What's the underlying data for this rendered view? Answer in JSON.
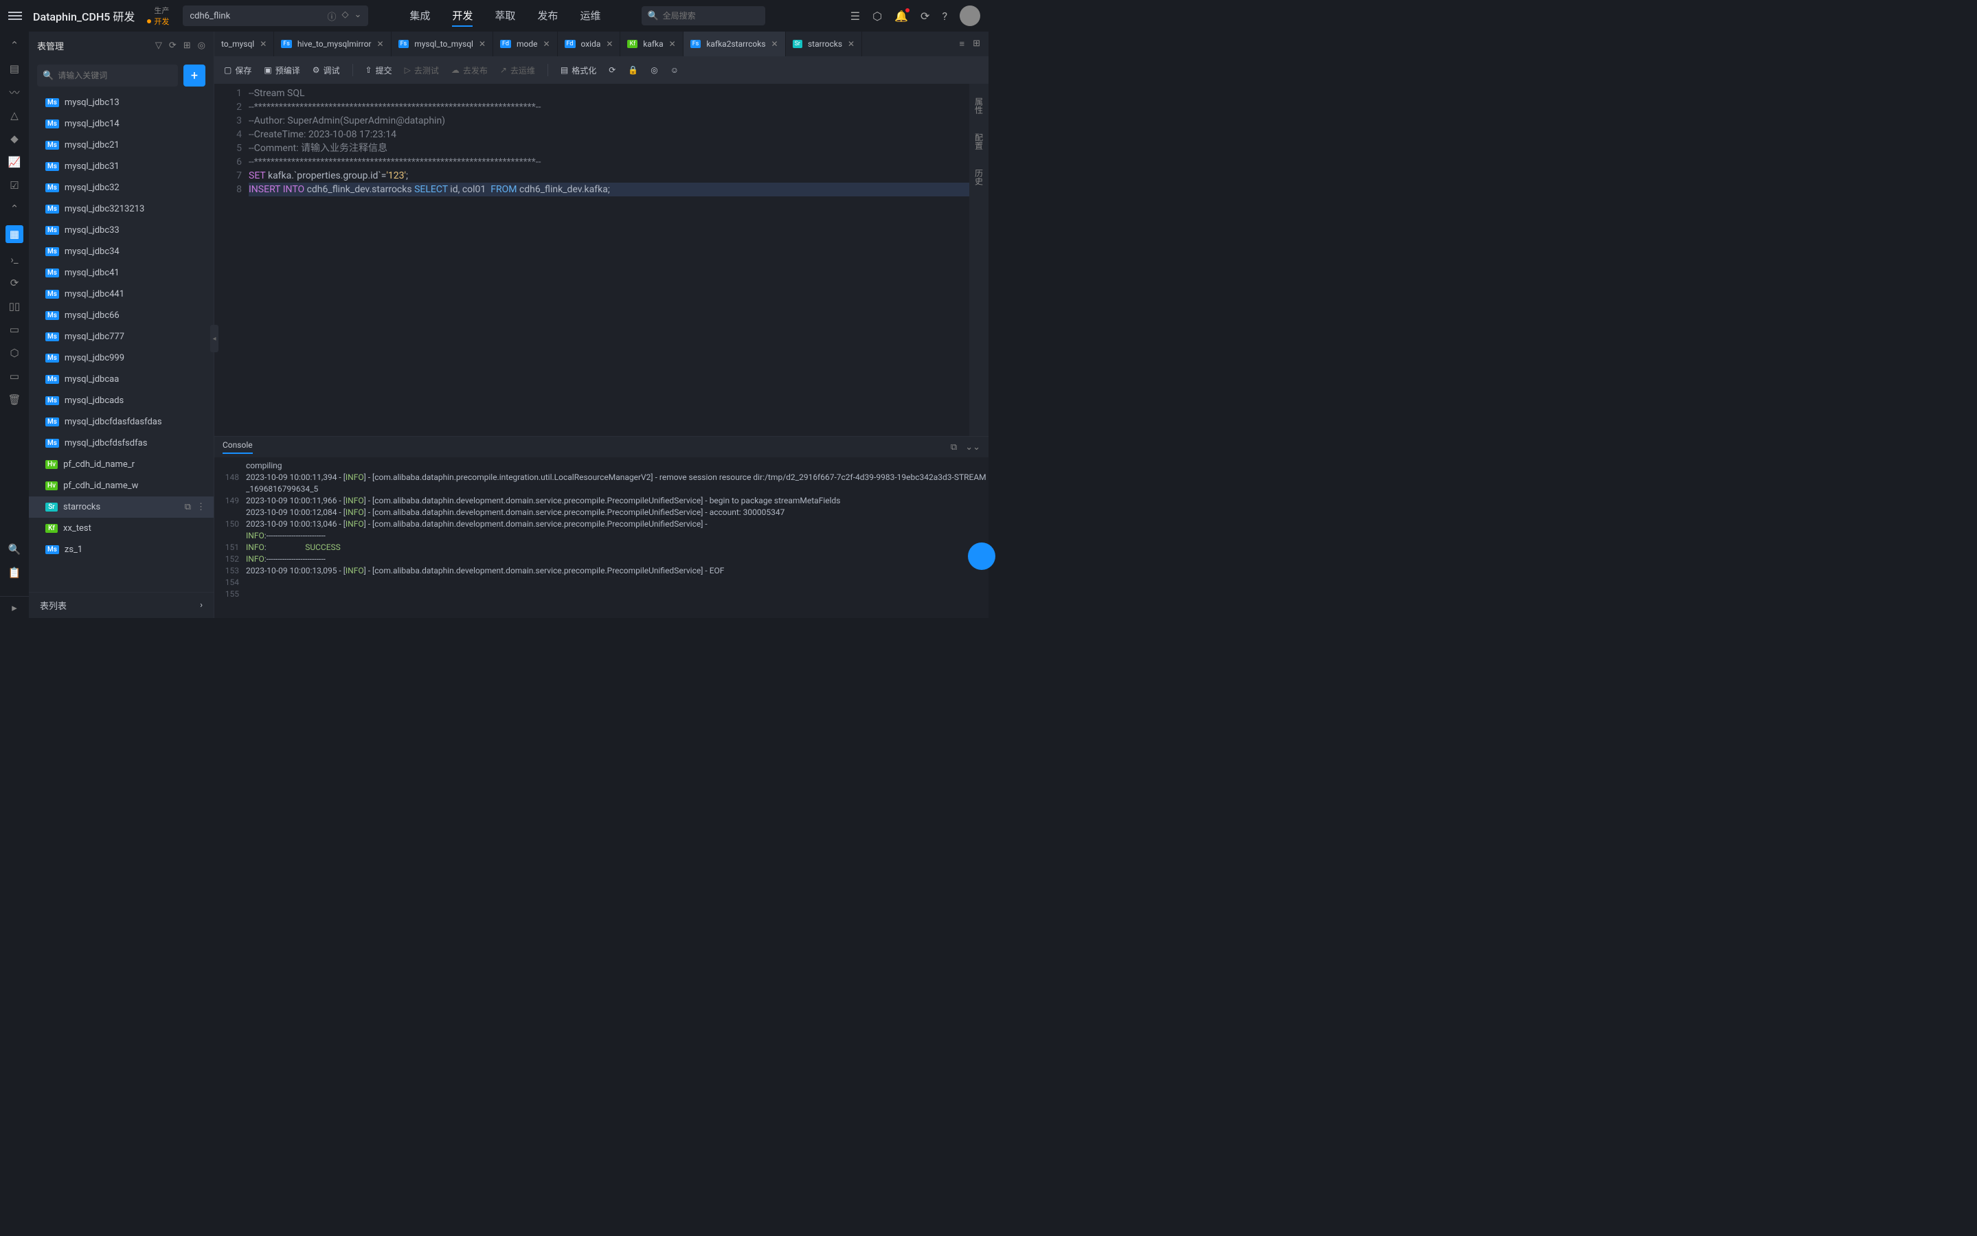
{
  "header": {
    "brand": "Dataphin_CDH5 研发",
    "env_l1": "生产",
    "env_l2": "开发",
    "workspace_value": "cdh6_flink",
    "nav": [
      "集成",
      "开发",
      "萃取",
      "发布",
      "运维"
    ],
    "nav_active": 1,
    "global_search_placeholder": "全局搜索"
  },
  "sidebar": {
    "title": "表管理",
    "search_placeholder": "请输入关键词",
    "items": [
      {
        "badge": "Ms",
        "cls": "b-ms",
        "name": "mysql_jdbc13"
      },
      {
        "badge": "Ms",
        "cls": "b-ms",
        "name": "mysql_jdbc14"
      },
      {
        "badge": "Ms",
        "cls": "b-ms",
        "name": "mysql_jdbc21"
      },
      {
        "badge": "Ms",
        "cls": "b-ms",
        "name": "mysql_jdbc31"
      },
      {
        "badge": "Ms",
        "cls": "b-ms",
        "name": "mysql_jdbc32"
      },
      {
        "badge": "Ms",
        "cls": "b-ms",
        "name": "mysql_jdbc3213213"
      },
      {
        "badge": "Ms",
        "cls": "b-ms",
        "name": "mysql_jdbc33"
      },
      {
        "badge": "Ms",
        "cls": "b-ms",
        "name": "mysql_jdbc34"
      },
      {
        "badge": "Ms",
        "cls": "b-ms",
        "name": "mysql_jdbc41"
      },
      {
        "badge": "Ms",
        "cls": "b-ms",
        "name": "mysql_jdbc441"
      },
      {
        "badge": "Ms",
        "cls": "b-ms",
        "name": "mysql_jdbc66"
      },
      {
        "badge": "Ms",
        "cls": "b-ms",
        "name": "mysql_jdbc777"
      },
      {
        "badge": "Ms",
        "cls": "b-ms",
        "name": "mysql_jdbc999"
      },
      {
        "badge": "Ms",
        "cls": "b-ms",
        "name": "mysql_jdbcaa"
      },
      {
        "badge": "Ms",
        "cls": "b-ms",
        "name": "mysql_jdbcads"
      },
      {
        "badge": "Ms",
        "cls": "b-ms",
        "name": "mysql_jdbcfdasfdasfdas"
      },
      {
        "badge": "Ms",
        "cls": "b-ms",
        "name": "mysql_jdbcfdsfsdfas"
      },
      {
        "badge": "Hv",
        "cls": "b-hv",
        "name": "pf_cdh_id_name_r"
      },
      {
        "badge": "Hv",
        "cls": "b-hv",
        "name": "pf_cdh_id_name_w"
      },
      {
        "badge": "Sr",
        "cls": "b-sr",
        "name": "starrocks",
        "active": true
      },
      {
        "badge": "Kf",
        "cls": "b-kf",
        "name": "xx_test"
      },
      {
        "badge": "Ms",
        "cls": "b-ms",
        "name": "zs_1"
      }
    ],
    "footer": "表列表"
  },
  "tabs": [
    {
      "badge": "",
      "cls": "",
      "label": "to_mysql"
    },
    {
      "badge": "Fs",
      "cls": "tb-fs",
      "label": "hive_to_mysqlmirror"
    },
    {
      "badge": "Fs",
      "cls": "tb-fs",
      "label": "mysql_to_mysql"
    },
    {
      "badge": "Fd",
      "cls": "tb-fd",
      "label": "mode"
    },
    {
      "badge": "Fd",
      "cls": "tb-fd",
      "label": "oxida"
    },
    {
      "badge": "Kf",
      "cls": "tb-kf",
      "label": "kafka"
    },
    {
      "badge": "Fs",
      "cls": "tb-fs",
      "label": "kafka2starrcoks",
      "active": true
    },
    {
      "badge": "Sr",
      "cls": "tb-sr",
      "label": "starrocks"
    }
  ],
  "toolbar": {
    "save": "保存",
    "precompile": "预编译",
    "debug": "调试",
    "submit": "提交",
    "test": "去测试",
    "publish": "去发布",
    "ops": "去运维",
    "format": "格式化"
  },
  "editor": {
    "lines": [
      {
        "n": 1,
        "raw": [
          {
            "t": "--Stream SQL",
            "c": "cmt"
          }
        ]
      },
      {
        "n": 2,
        "raw": [
          {
            "t": "--********************************************************************--",
            "c": "cmt"
          }
        ]
      },
      {
        "n": 3,
        "raw": [
          {
            "t": "--Author: SuperAdmin(SuperAdmin@dataphin)",
            "c": "cmt"
          }
        ]
      },
      {
        "n": 4,
        "raw": [
          {
            "t": "--CreateTime: 2023-10-08 17:23:14",
            "c": "cmt"
          }
        ]
      },
      {
        "n": 5,
        "raw": [
          {
            "t": "--Comment: 请输入业务注释信息",
            "c": "cmt"
          }
        ]
      },
      {
        "n": 6,
        "raw": [
          {
            "t": "--********************************************************************--",
            "c": "cmt"
          }
        ]
      },
      {
        "n": 7,
        "raw": [
          {
            "t": "SET",
            "c": "kw"
          },
          {
            "t": " kafka.`properties.group.id`="
          },
          {
            "t": "'123'",
            "c": "str"
          },
          {
            "t": ";"
          }
        ]
      },
      {
        "n": 8,
        "hl": true,
        "raw": [
          {
            "t": "INSERT",
            "c": "kw"
          },
          {
            "t": " "
          },
          {
            "t": "INTO",
            "c": "kw"
          },
          {
            "t": " cdh6_flink_dev.starrocks "
          },
          {
            "t": "SELECT",
            "c": "kw2"
          },
          {
            "t": " id, col01  "
          },
          {
            "t": "FROM",
            "c": "kw2"
          },
          {
            "t": " cdh6_flink_dev.kafka;"
          }
        ]
      }
    ]
  },
  "right_rail": [
    "属性",
    "配置",
    "历史"
  ],
  "console": {
    "tab": "Console",
    "entries": [
      {
        "n": "",
        "text": "compiling"
      },
      {
        "n": "148",
        "text": "2023-10-09 10:00:11,394 - [",
        "info": "INFO",
        "rest": "] - [com.alibaba.dataphin.precompile.integration.util.LocalResourceManagerV2] - remove session resource dir:/tmp/d2_2916f667-7c2f-4d39-9983-19ebc342a3d3-STREAM_1696816799634_5"
      },
      {
        "n": "149",
        "text": "2023-10-09 10:00:11,966 - [",
        "info": "INFO",
        "rest": "] - [com.alibaba.dataphin.development.domain.service.precompile.PrecompileUnifiedService] - begin to package streamMetaFields"
      },
      {
        "n": "150",
        "text": "2023-10-09 10:00:12,084 - [",
        "info": "INFO",
        "rest": "] - [com.alibaba.dataphin.development.domain.service.precompile.PrecompileUnifiedService] - account: 300005347"
      },
      {
        "n": "151",
        "text": "2023-10-09 10:00:13,046 - [",
        "info": "INFO",
        "rest": "] - [com.alibaba.dataphin.development.domain.service.precompile.PrecompileUnifiedService] - "
      },
      {
        "n": "152",
        "info_start": "INFO",
        "text": ":--------------------------"
      },
      {
        "n": "153",
        "info_start": "INFO",
        "text": ":                   ",
        "success": "SUCCESS"
      },
      {
        "n": "154",
        "info_start": "INFO",
        "text": ":--------------------------"
      },
      {
        "n": "155",
        "text": "2023-10-09 10:00:13,095 - [",
        "info": "INFO",
        "rest": "] - [com.alibaba.dataphin.development.domain.service.precompile.PrecompileUnifiedService] - EOF"
      }
    ]
  }
}
